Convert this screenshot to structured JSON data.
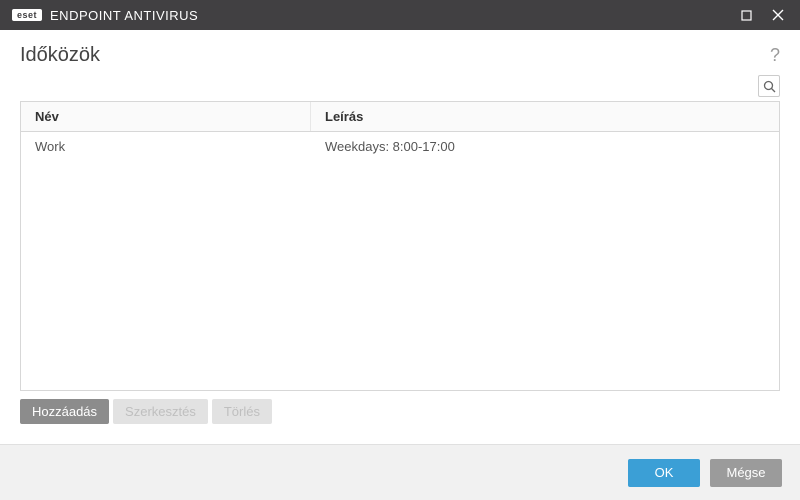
{
  "titlebar": {
    "logo_text": "eset",
    "product_name": "ENDPOINT ANTIVIRUS"
  },
  "header": {
    "title": "Időközök",
    "help": "?"
  },
  "table": {
    "columns": {
      "name": "Név",
      "desc": "Leírás"
    },
    "rows": [
      {
        "name": "Work",
        "desc": "Weekdays: 8:00-17:00"
      }
    ]
  },
  "actions": {
    "add": "Hozzáadás",
    "edit": "Szerkesztés",
    "delete": "Törlés"
  },
  "footer": {
    "ok": "OK",
    "cancel": "Mégse"
  }
}
